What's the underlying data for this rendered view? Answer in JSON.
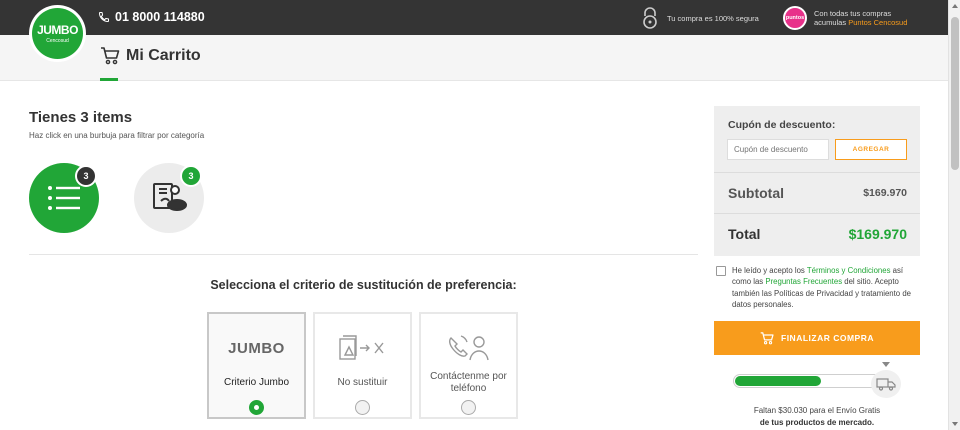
{
  "topbar": {
    "logo_text": "JUMBO",
    "logo_sub": "Cencosud",
    "phone": "01 8000 114880",
    "secure_text": "Tu compra es 100% segura",
    "puntos_badge": "puntos",
    "puntos_line1": "Con todas tus compras",
    "puntos_line2_prefix": "acumulas ",
    "puntos_line2_highlight": "Puntos Cencosud"
  },
  "header": {
    "title": "Mi Carrito"
  },
  "items": {
    "title": "Tienes 3 items",
    "subtitle": "Haz click en una burbuja para filtrar por categoría",
    "bubbles": [
      {
        "icon": "list-icon",
        "count": "3"
      },
      {
        "icon": "groceries-icon",
        "count": "3"
      }
    ]
  },
  "criteria": {
    "title": "Selecciona el criterio de sustitución de preferencia:",
    "options": [
      {
        "label": "Criterio Jumbo",
        "icon_text": "JUMBO",
        "selected": true
      },
      {
        "label": "No sustituir",
        "icon": "no-substitute-icon",
        "selected": false
      },
      {
        "label": "Contáctenme por teléfono",
        "icon": "phone-contact-icon",
        "selected": false
      }
    ]
  },
  "summary": {
    "coupon_label": "Cupón de descuento:",
    "coupon_placeholder": "Cupón de descuento",
    "coupon_button": "AGREGAR",
    "subtotal_label": "Subtotal",
    "subtotal_value": "$169.970",
    "total_label": "Total",
    "total_value": "$169.970"
  },
  "terms": {
    "t1": "He leído y acepto los ",
    "link1": "Términos y Condiciones",
    "t2": " así como las ",
    "link2": "Preguntas Frecuentes",
    "t3": " del sitio. Acepto también las Políticas de Privacidad y tratamiento de datos personales."
  },
  "checkout": {
    "button_label": "FINALIZAR COMPRA"
  },
  "shipping": {
    "progress_fraction": 0.6,
    "line1": "Faltan $30.030 para el Envío Gratis",
    "line2": "de tus productos de mercado."
  },
  "colors": {
    "green": "#21a637",
    "orange": "#f89c1c",
    "dark": "#343434"
  }
}
